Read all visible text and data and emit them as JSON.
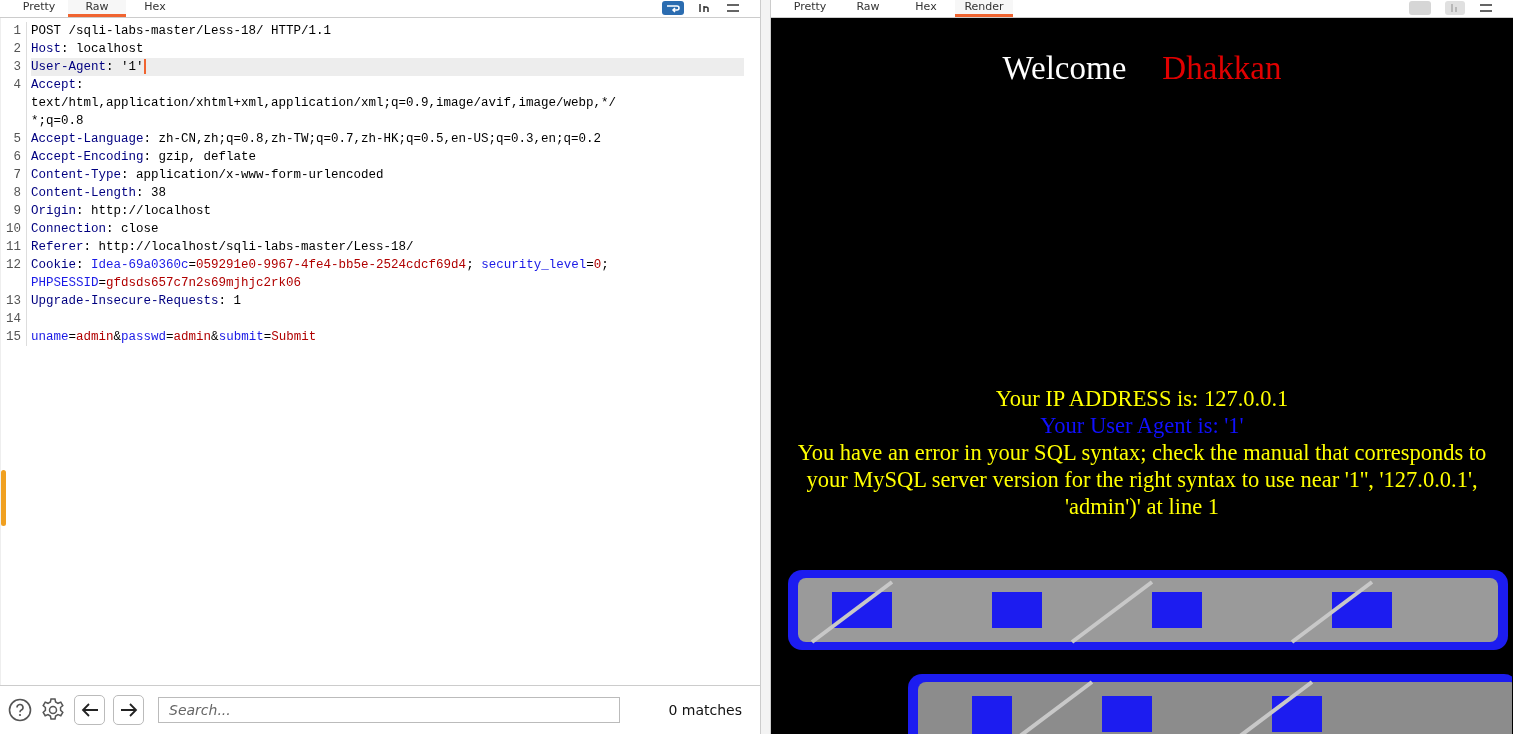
{
  "request_pane": {
    "tabs": [
      {
        "label": "Pretty",
        "selected": false
      },
      {
        "label": "Raw",
        "selected": true
      },
      {
        "label": "Hex",
        "selected": false
      }
    ],
    "lines": [
      {
        "number": "1",
        "current": false,
        "rows": [
          [
            {
              "kind": "text",
              "text": "POST /sqli-labs-master/Less-18/ HTTP/1.1"
            }
          ]
        ]
      },
      {
        "number": "2",
        "current": false,
        "rows": [
          [
            {
              "kind": "name",
              "text": "Host"
            },
            {
              "kind": "text",
              "text": ": localhost"
            }
          ]
        ]
      },
      {
        "number": "3",
        "current": true,
        "rows": [
          [
            {
              "kind": "name",
              "text": "User-Agent"
            },
            {
              "kind": "text",
              "text": ": '1'"
            }
          ]
        ]
      },
      {
        "number": "4",
        "current": false,
        "rows": [
          [
            {
              "kind": "name",
              "text": "Accept"
            },
            {
              "kind": "text",
              "text": ":"
            }
          ],
          [
            {
              "kind": "text",
              "text": "text/html,application/xhtml+xml,application/xml;q=0.9,image/avif,image/webp,*/"
            }
          ],
          [
            {
              "kind": "text",
              "text": "*;q=0.8"
            }
          ]
        ]
      },
      {
        "number": "5",
        "current": false,
        "rows": [
          [
            {
              "kind": "name",
              "text": "Accept-Language"
            },
            {
              "kind": "text",
              "text": ": zh-CN,zh;q=0.8,zh-TW;q=0.7,zh-HK;q=0.5,en-US;q=0.3,en;q=0.2"
            }
          ]
        ]
      },
      {
        "number": "6",
        "current": false,
        "rows": [
          [
            {
              "kind": "name",
              "text": "Accept-Encoding"
            },
            {
              "kind": "text",
              "text": ": gzip, deflate"
            }
          ]
        ]
      },
      {
        "number": "7",
        "current": false,
        "rows": [
          [
            {
              "kind": "name",
              "text": "Content-Type"
            },
            {
              "kind": "text",
              "text": ": application/x-www-form-urlencoded"
            }
          ]
        ]
      },
      {
        "number": "8",
        "current": false,
        "rows": [
          [
            {
              "kind": "name",
              "text": "Content-Length"
            },
            {
              "kind": "text",
              "text": ": 38"
            }
          ]
        ]
      },
      {
        "number": "9",
        "current": false,
        "rows": [
          [
            {
              "kind": "name",
              "text": "Origin"
            },
            {
              "kind": "text",
              "text": ": http://localhost"
            }
          ]
        ]
      },
      {
        "number": "10",
        "current": false,
        "rows": [
          [
            {
              "kind": "name",
              "text": "Connection"
            },
            {
              "kind": "text",
              "text": ": close"
            }
          ]
        ]
      },
      {
        "number": "11",
        "current": false,
        "rows": [
          [
            {
              "kind": "name",
              "text": "Referer"
            },
            {
              "kind": "text",
              "text": ": http://localhost/sqli-labs-master/Less-18/"
            }
          ]
        ]
      },
      {
        "number": "12",
        "current": false,
        "rows": [
          [
            {
              "kind": "name",
              "text": "Cookie"
            },
            {
              "kind": "text",
              "text": ": "
            },
            {
              "kind": "key",
              "text": "Idea-69a0360c"
            },
            {
              "kind": "text",
              "text": "="
            },
            {
              "kind": "value",
              "text": "059291e0-9967-4fe4-bb5e-2524cdcf69d4"
            },
            {
              "kind": "text",
              "text": "; "
            },
            {
              "kind": "key",
              "text": "security_level"
            },
            {
              "kind": "text",
              "text": "="
            },
            {
              "kind": "value",
              "text": "0"
            },
            {
              "kind": "text",
              "text": "; "
            },
            {
              "kind": "key",
              "text": "PHPSESSID"
            },
            {
              "kind": "text",
              "text": "="
            },
            {
              "kind": "value",
              "text": "gfdsds657c7n2s69mjhjc2rk06"
            }
          ]
        ]
      },
      {
        "number": "13",
        "current": false,
        "rows": [
          [
            {
              "kind": "name",
              "text": "Upgrade-Insecure-Requests"
            },
            {
              "kind": "text",
              "text": ": 1"
            }
          ]
        ]
      },
      {
        "number": "14",
        "current": false,
        "rows": [
          []
        ]
      },
      {
        "number": "15",
        "current": false,
        "rows": [
          [
            {
              "kind": "key",
              "text": "uname"
            },
            {
              "kind": "text",
              "text": "="
            },
            {
              "kind": "value",
              "text": "admin"
            },
            {
              "kind": "text",
              "text": "&"
            },
            {
              "kind": "key",
              "text": "passwd"
            },
            {
              "kind": "text",
              "text": "="
            },
            {
              "kind": "value",
              "text": "admin"
            },
            {
              "kind": "text",
              "text": "&"
            },
            {
              "kind": "key",
              "text": "submit"
            },
            {
              "kind": "text",
              "text": "="
            },
            {
              "kind": "value",
              "text": "Submit"
            }
          ]
        ]
      }
    ],
    "search": {
      "placeholder": "Search..."
    },
    "matches": "0 matches"
  },
  "response_pane": {
    "tabs": [
      {
        "label": "Pretty",
        "selected": false
      },
      {
        "label": "Raw",
        "selected": false
      },
      {
        "label": "Hex",
        "selected": false
      },
      {
        "label": "Render",
        "selected": true
      }
    ],
    "welcome": "Welcome",
    "user": "Dhakkan",
    "messages": [
      {
        "kind": "info",
        "text": "Your IP ADDRESS is: 127.0.0.1"
      },
      {
        "kind": "agent",
        "text": "Your User Agent is: '1'"
      },
      {
        "kind": "info",
        "text": "You have an error in your SQL syntax; check the manual that corresponds to your MySQL server version for the right syntax to use near '1'', '127.0.0.1', 'admin')' at line 1"
      }
    ]
  }
}
